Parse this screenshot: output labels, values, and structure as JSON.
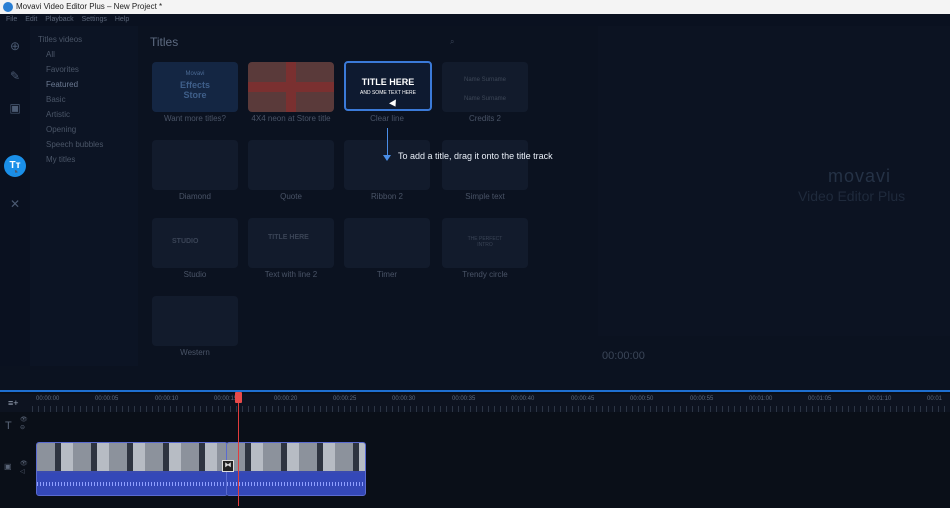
{
  "window": {
    "title": "Movavi Video Editor Plus – New Project *"
  },
  "menu": {
    "items": [
      "File",
      "Edit",
      "Playback",
      "Settings",
      "Help"
    ]
  },
  "left_nav": {
    "icons": [
      "import-icon",
      "magic-wand-icon",
      "filters-icon",
      "titles-icon",
      "transitions-icon",
      "tools-icon"
    ],
    "active_label": "Tт"
  },
  "categories": {
    "items": [
      "Titles videos",
      "All",
      "Favorites",
      "Featured",
      "Basic",
      "Artistic",
      "Opening",
      "Speech bubbles",
      "My titles"
    ]
  },
  "titles_panel": {
    "heading": "Titles",
    "thumbs": [
      {
        "label": "Want more titles?",
        "line1": "Movavi",
        "line2": "Effects\nStore"
      },
      {
        "label": "4X4 neon at Store title",
        "line1": "",
        "line2": ""
      },
      {
        "label": "Clear line",
        "line1": "TITLE HERE",
        "line2": "AND SOME TEXT HERE"
      },
      {
        "label": "Credits 2",
        "line1": "Name Surname",
        "line2": "Name Surname"
      },
      {
        "label": "Diamond",
        "line1": "",
        "line2": ""
      },
      {
        "label": "Quote",
        "line1": "",
        "line2": ""
      },
      {
        "label": "Ribbon 2",
        "line1": "",
        "line2": ""
      },
      {
        "label": "Simple text",
        "line1": "",
        "line2": ""
      },
      {
        "label": "Studio",
        "line1": "STUDIO",
        "line2": ""
      },
      {
        "label": "Text with line 2",
        "line1": "TITLE HERE",
        "line2": ""
      },
      {
        "label": "Timer",
        "line1": "",
        "line2": ""
      },
      {
        "label": "Trendy circle",
        "line1": "THE PERFECT INTRO",
        "line2": ""
      },
      {
        "label": "Western",
        "line1": "",
        "line2": ""
      }
    ]
  },
  "hint": {
    "text": "To add a title, drag it onto the title track"
  },
  "player": {
    "logo": "movavi",
    "tagline": "Video Editor Plus",
    "time": "00:00:00"
  },
  "timeline": {
    "ticks": [
      "00:00:00",
      "00:00:05",
      "00:00:10",
      "00:00:15",
      "00:00:20",
      "00:00:25",
      "00:00:30",
      "00:00:35",
      "00:00:40",
      "00:00:45",
      "00:00:50",
      "00:00:55",
      "00:01:00",
      "00:01:05",
      "00:01:10",
      "00:01"
    ],
    "title_track_label": "T"
  },
  "colors": {
    "accent": "#1a8fe8",
    "playhead": "#e03c3c",
    "clip": "#3448b8"
  }
}
